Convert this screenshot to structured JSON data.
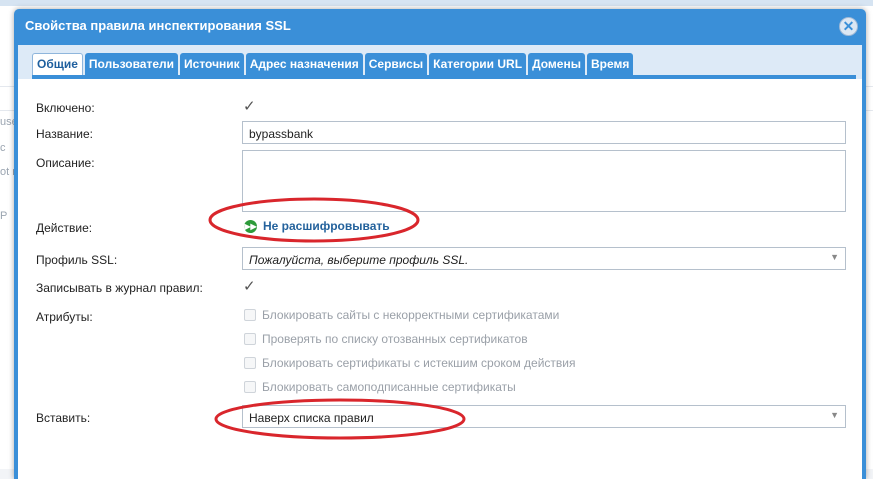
{
  "dialog": {
    "title": "Свойства правила инспектирования SSL",
    "close_icon": "close-icon",
    "tabs": [
      {
        "label": "Общие",
        "active": true
      },
      {
        "label": "Пользователи"
      },
      {
        "label": "Источник"
      },
      {
        "label": "Адрес назначения"
      },
      {
        "label": "Сервисы"
      },
      {
        "label": "Категории URL"
      },
      {
        "label": "Домены"
      },
      {
        "label": "Время"
      }
    ]
  },
  "form": {
    "enabled_label": "Включено:",
    "enabled_checked": true,
    "name_label": "Название:",
    "name_value": "bypassbank",
    "description_label": "Описание:",
    "description_value": "",
    "action_label": "Действие:",
    "action_value": "Не расшифровывать",
    "ssl_profile_label": "Профиль SSL:",
    "ssl_profile_placeholder": "Пожалуйста, выберите профиль SSL.",
    "log_label": "Записывать в журнал правил:",
    "log_checked": true,
    "attributes_label": "Атрибуты:",
    "attributes": [
      "Блокировать сайты с некорректными сертификатами",
      "Проверять по списку отозванных сертификатов",
      "Блокировать сертификаты с истекшим сроком действия",
      "Блокировать самоподписанные сертификаты"
    ],
    "insert_label": "Вставить:",
    "insert_value": "Наверх списка правил"
  },
  "background": {
    "fragments": [
      "use",
      "c",
      "ot r",
      "P"
    ]
  },
  "colors": {
    "dialog_blue": "#3a8fd8",
    "action_green": "#2e9b3a",
    "annotation_red": "#d9262c"
  }
}
